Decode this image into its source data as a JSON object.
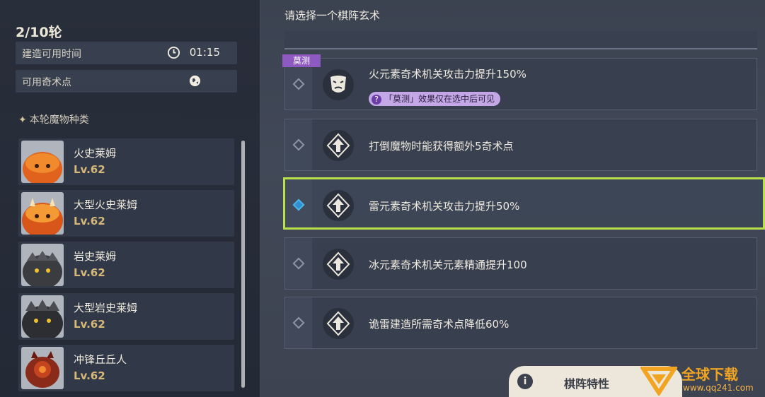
{
  "left": {
    "round": "2/10轮",
    "build_time_label": "建造可用时间",
    "build_time_value": "01:15",
    "points_label": "可用奇术点",
    "points_value": "0",
    "section_title": "本轮魔物种类",
    "monsters": [
      {
        "name": "火史莱姆",
        "level": "Lv.62"
      },
      {
        "name": "大型火史莱姆",
        "level": "Lv.62"
      },
      {
        "name": "岩史莱姆",
        "level": "Lv.62"
      },
      {
        "name": "大型岩史莱姆",
        "level": "Lv.62"
      },
      {
        "name": "冲锋丘丘人",
        "level": "Lv.62"
      }
    ]
  },
  "right": {
    "title": "请选择一个棋阵玄术",
    "tag": "莫测",
    "hint": "「莫测」效果仅在选中后可见",
    "options": [
      {
        "text": "火元素奇术机关攻击力提升150%",
        "icon": "mask-icon"
      },
      {
        "text": "打倒魔物时能获得额外5奇术点",
        "icon": "arrow-up-icon"
      },
      {
        "text": "雷元素奇术机关攻击力提升50%",
        "icon": "arrow-up-icon"
      },
      {
        "text": "冰元素奇术机关元素精通提升100",
        "icon": "arrow-up-icon"
      },
      {
        "text": "诡雷建造所需奇术点降低60%",
        "icon": "arrow-up-icon"
      }
    ],
    "selected_index": 2
  },
  "bottom": {
    "button_label": "棋阵特性"
  },
  "watermark": {
    "title": "全球下载",
    "url": "www.qq241.com"
  },
  "colors": {
    "selected_border": "#b9e24a",
    "tag_purple": "#8e5ac1",
    "level_gold": "#d7b877"
  }
}
